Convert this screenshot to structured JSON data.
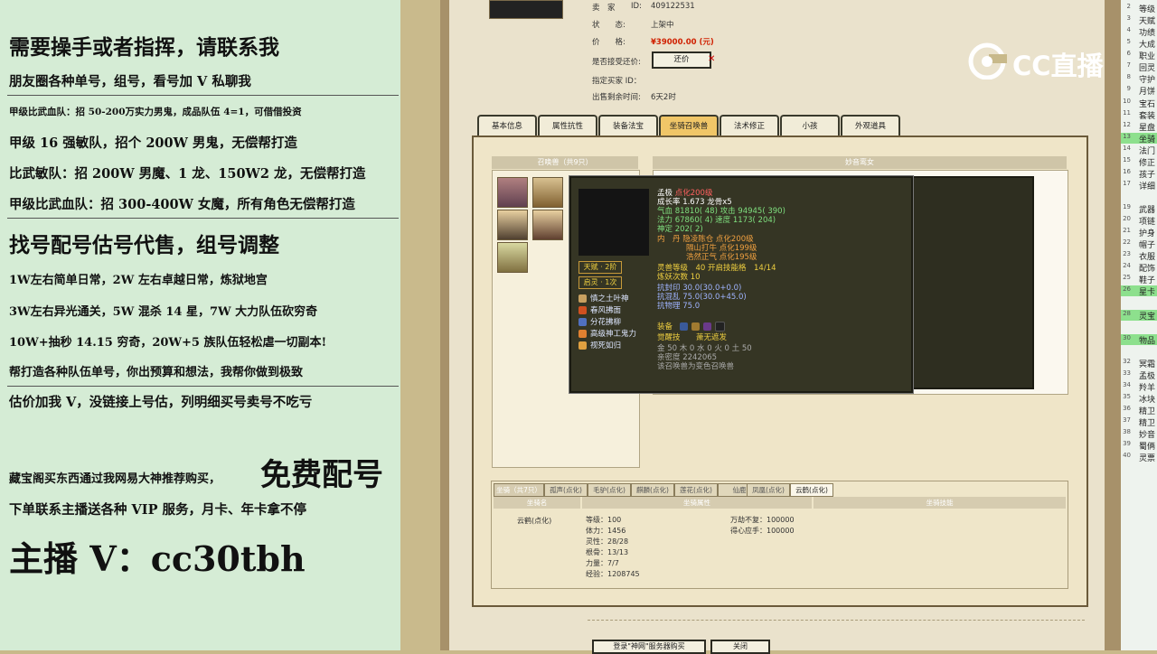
{
  "left_panel": {
    "lines": [
      "需要操手或者指挥，请联系我",
      "朋友圈各种单号，组号，看号加 V 私聊我",
      "甲级比武血队：招 50-200万实力男鬼，成品队伍 4=1，可借借投资",
      "甲级 16 强敏队，招个 200W 男鬼，无偿帮打造",
      "比武敏队：招 200W 男魔、1 龙、150W2 龙，无偿帮打造",
      "甲级比武血队：招 300-400W 女魔，所有角色无偿帮打造",
      "找号配号估号代售，组号调整",
      "1W左右简单日常，2W 左右卓越日常，炼狱地宫",
      "3W左右异光通关，5W 混杀 14 星，7W 大力队伍砍穷奇",
      "10W+抽秒 14.15 穷奇，20W+5 族队伍轻松虐一切副本!",
      "帮打造各种队伍单号，你出预算和想法，我帮你做到极致",
      "估价加我 V，没链接上号估，列明细买号卖号不吃亏",
      "藏宝阁买东西通过我网易大神推荐购买，",
      "免费配号",
      "下单联系主播送各种 VIP 服务，月卡、年卡拿不停",
      "主播 V：cc30tbh"
    ]
  },
  "seller": {
    "label_seller": "卖　家",
    "label_id": "ID:",
    "id": "409122531",
    "label_status": "状　　态:",
    "status": "上架中",
    "label_price": "价　　格:",
    "price": "¥39000.00 (元)",
    "label_bargain": "是否接受还价:",
    "bargain_button": "还价",
    "label_buyer": "指定买家 ID：",
    "label_remain": "出售剩余时间:",
    "remain": "6天2时"
  },
  "tabs": [
    "基本信息",
    "属性抗性",
    "装备法宝",
    "坐骑召唤兽",
    "法术修正",
    "小孩",
    "外观道具"
  ],
  "active_tab": 3,
  "pet_panel": {
    "header": "召唤兽（共9只）",
    "right_header": "妙音鸾女"
  },
  "tooltip": {
    "name": "孟极",
    "level": "点化200级",
    "line_growth": "成长率 1.673  龙骨x5",
    "line_hp_atk": "气血 81810( 48)  攻击 94945( 390)",
    "line_mp_spd": "法力 67860( 4)  速度 1173( 204)",
    "line_shen": "神定 202( 2)",
    "line_dan1": "内　丹  隐凌陈仓 点化200级",
    "line_dan2": "隔山打牛 点化199级",
    "line_dan3": "浩然正气 点化195级",
    "line_lingshou": "灵兽等级　40  开启技能格　14/14",
    "line_lianyao": "炼妖次数 10",
    "line_kfy": "抗封印 30.0(30.0+0.0)",
    "line_khl": "抗混乱 75.0(30.0+45.0)",
    "line_kwl": "抗物理 75.0",
    "line_equip": "装备",
    "line_juexing_label": "觉醒技",
    "line_juexing": "萧无遮发",
    "line_wuxing": "金 50  木 0  水 0  火 0  土 50",
    "line_qinmi": "亲密度 2242065",
    "line_note": "该召唤兽为变色召唤兽",
    "badge_tianfu": "天赋 · 2阶",
    "badge_qiling": "启灵 · 1次",
    "skills": [
      "慎之土叶神",
      "春风拂面",
      "分花拂柳",
      "高级神工鬼力",
      "视死如归"
    ]
  },
  "mount": {
    "title": "坐骑（共7只）",
    "tabs": [
      "孤声(点化)",
      "毛驴(点化)",
      "麒麟(点化)",
      "莲花(点化)",
      "仙鹿",
      "凤凰(点化)",
      "云鹤(点化)"
    ],
    "col_name": "坐骑名",
    "col_attr": "坐骑属性",
    "col_skill": "坐骑技能",
    "name": "云鹤(点化)",
    "attrs": [
      "等级：100",
      "体力：1456",
      "灵性：28/28",
      "根骨：13/13",
      "力量：7/7",
      "经验：1208745"
    ],
    "skills": [
      "万劫不复：100000",
      "得心应手：100000"
    ]
  },
  "right_list": [
    {
      "n": "2",
      "t": "等级"
    },
    {
      "n": "3",
      "t": "天赋"
    },
    {
      "n": "4",
      "t": "功绩"
    },
    {
      "n": "5",
      "t": "大成"
    },
    {
      "n": "6",
      "t": "职业"
    },
    {
      "n": "7",
      "t": "回灵"
    },
    {
      "n": "8",
      "t": "守护"
    },
    {
      "n": "9",
      "t": "月饼"
    },
    {
      "n": "10",
      "t": "宝石"
    },
    {
      "n": "11",
      "t": "套装"
    },
    {
      "n": "12",
      "t": "星盘"
    },
    {
      "n": "13",
      "t": "坐骑"
    },
    {
      "n": "14",
      "t": "法门"
    },
    {
      "n": "15",
      "t": "修正"
    },
    {
      "n": "16",
      "t": "孩子"
    },
    {
      "n": "17",
      "t": "详细"
    },
    {
      "n": "19",
      "t": "武器"
    },
    {
      "n": "20",
      "t": "项链"
    },
    {
      "n": "21",
      "t": "护身"
    },
    {
      "n": "22",
      "t": "帽子"
    },
    {
      "n": "23",
      "t": "衣服"
    },
    {
      "n": "24",
      "t": "配饰"
    },
    {
      "n": "25",
      "t": "鞋子"
    },
    {
      "n": "26",
      "t": "星卡"
    },
    {
      "n": "28",
      "t": "灵宝"
    },
    {
      "n": "30",
      "t": "物品"
    },
    {
      "n": "32",
      "t": "冥霜"
    },
    {
      "n": "33",
      "t": "孟极"
    },
    {
      "n": "34",
      "t": "羚羊"
    },
    {
      "n": "35",
      "t": "冰块"
    },
    {
      "n": "36",
      "t": "精卫"
    },
    {
      "n": "37",
      "t": "精卫"
    },
    {
      "n": "38",
      "t": "妙音"
    },
    {
      "n": "39",
      "t": "蜀俩"
    },
    {
      "n": "40",
      "t": "灵票"
    }
  ],
  "logo": {
    "text": "CC直播"
  },
  "bottom": {
    "btn1": "登录\"神网\"服务器购买",
    "btn2": "关闭"
  }
}
